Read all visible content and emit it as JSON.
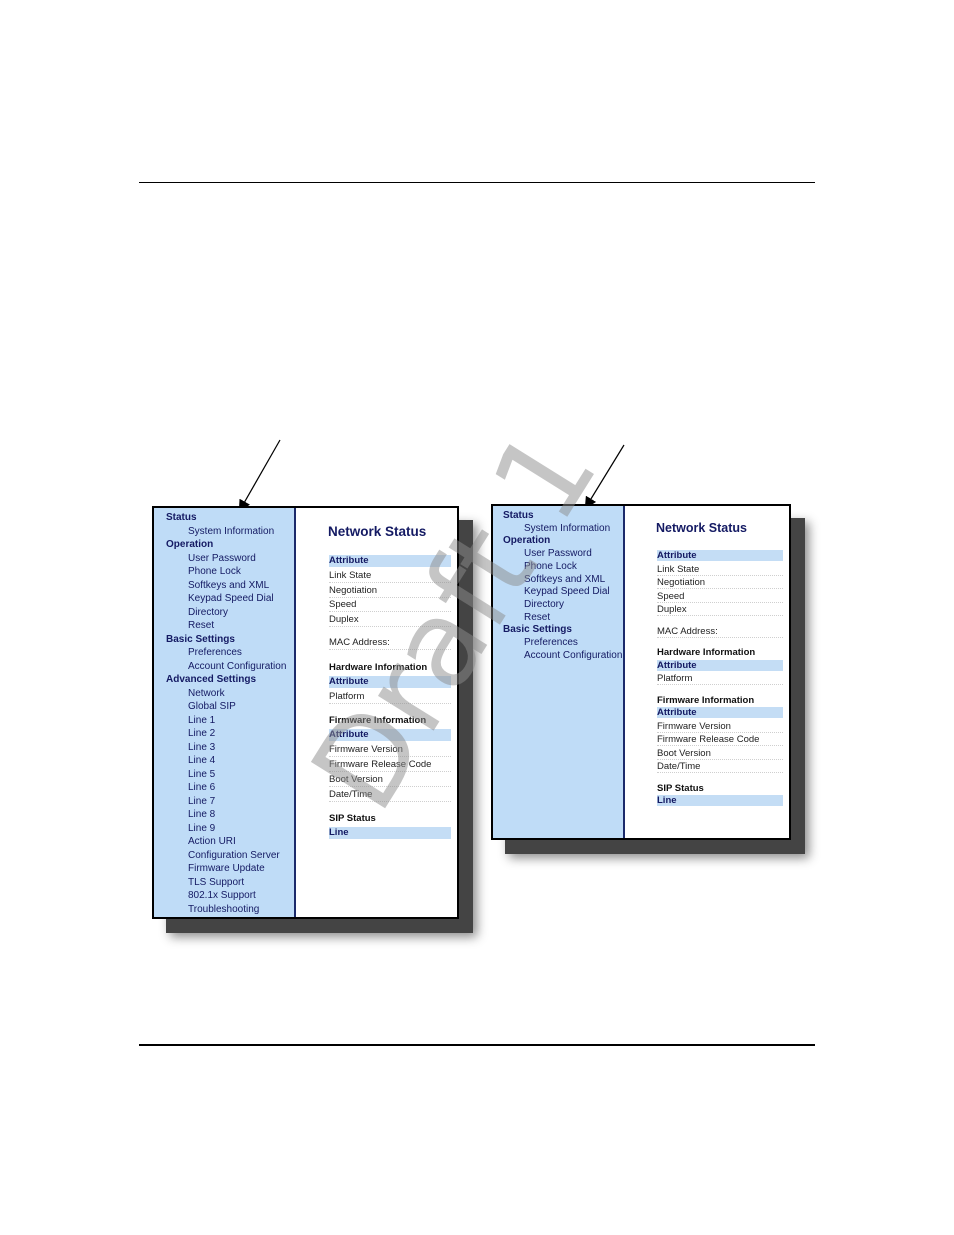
{
  "panel1": {
    "nav": [
      {
        "label": "Status",
        "head": true
      },
      {
        "label": "System Information",
        "head": false
      },
      {
        "label": "Operation",
        "head": true
      },
      {
        "label": "User Password",
        "head": false
      },
      {
        "label": "Phone Lock",
        "head": false
      },
      {
        "label": "Softkeys and XML",
        "head": false
      },
      {
        "label": "Keypad Speed Dial",
        "head": false
      },
      {
        "label": "Directory",
        "head": false
      },
      {
        "label": "Reset",
        "head": false
      },
      {
        "label": "Basic Settings",
        "head": true
      },
      {
        "label": "Preferences",
        "head": false
      },
      {
        "label": "Account Configuration",
        "head": false
      },
      {
        "label": "Advanced Settings",
        "head": true
      },
      {
        "label": "Network",
        "head": false
      },
      {
        "label": "Global SIP",
        "head": false
      },
      {
        "label": "Line 1",
        "head": false
      },
      {
        "label": "Line 2",
        "head": false
      },
      {
        "label": "Line 3",
        "head": false
      },
      {
        "label": "Line 4",
        "head": false
      },
      {
        "label": "Line 5",
        "head": false
      },
      {
        "label": "Line 6",
        "head": false
      },
      {
        "label": "Line 7",
        "head": false
      },
      {
        "label": "Line 8",
        "head": false
      },
      {
        "label": "Line 9",
        "head": false
      },
      {
        "label": "Action URI",
        "head": false
      },
      {
        "label": "Configuration Server",
        "head": false
      },
      {
        "label": "Firmware Update",
        "head": false
      },
      {
        "label": "TLS Support",
        "head": false
      },
      {
        "label": "802.1x Support",
        "head": false
      },
      {
        "label": "Troubleshooting",
        "head": false
      }
    ]
  },
  "panel2": {
    "nav": [
      {
        "label": "Status",
        "head": true
      },
      {
        "label": "System Information",
        "head": false
      },
      {
        "label": "Operation",
        "head": true
      },
      {
        "label": "User Password",
        "head": false
      },
      {
        "label": "Phone Lock",
        "head": false
      },
      {
        "label": "Softkeys and XML",
        "head": false
      },
      {
        "label": "Keypad Speed Dial",
        "head": false
      },
      {
        "label": "Directory",
        "head": false
      },
      {
        "label": "Reset",
        "head": false
      },
      {
        "label": "Basic Settings",
        "head": true
      },
      {
        "label": "Preferences",
        "head": false
      },
      {
        "label": "Account Configuration",
        "head": false
      }
    ]
  },
  "content": {
    "title": "Network Status",
    "items": [
      {
        "label": "Attribute",
        "kind": "bar"
      },
      {
        "label": "Link State",
        "kind": "row"
      },
      {
        "label": "Negotiation",
        "kind": "row"
      },
      {
        "label": "Speed",
        "kind": "row"
      },
      {
        "label": "Duplex",
        "kind": "row"
      },
      {
        "label": "MAC Address:",
        "kind": "row"
      },
      {
        "label": "Hardware Information",
        "kind": "section"
      },
      {
        "label": "Attribute",
        "kind": "bar"
      },
      {
        "label": "Platform",
        "kind": "row"
      },
      {
        "label": "Firmware Information",
        "kind": "section"
      },
      {
        "label": "Attribute",
        "kind": "bar"
      },
      {
        "label": "Firmware Version",
        "kind": "row"
      },
      {
        "label": "Firmware Release Code",
        "kind": "row"
      },
      {
        "label": "Boot Version",
        "kind": "row"
      },
      {
        "label": "Date/Time",
        "kind": "row"
      },
      {
        "label": "SIP Status",
        "kind": "section"
      },
      {
        "label": "Line",
        "kind": "bar"
      }
    ]
  },
  "watermark": "Draft 1"
}
